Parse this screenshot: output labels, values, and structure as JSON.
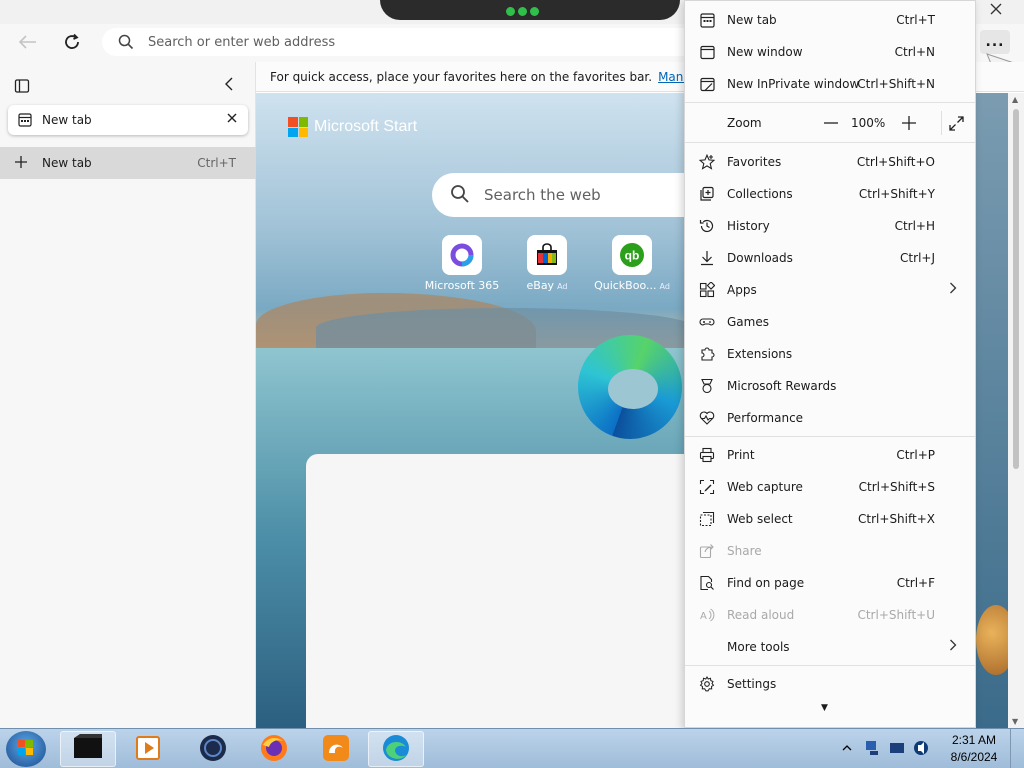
{
  "browser": {
    "address_placeholder": "Search or enter web address",
    "more_button_label": "...",
    "favorites_bar_message": "For quick access, place your favorites here on the favorites bar.",
    "favorites_bar_link": "Manage fav"
  },
  "sidebar": {
    "tabs": [
      {
        "title": "New tab"
      }
    ],
    "new_tab_label": "New tab",
    "new_tab_shortcut": "Ctrl+T"
  },
  "new_tab_page": {
    "logo_label": "Microsoft Start",
    "search_placeholder": "Search the web",
    "quick_links": [
      {
        "label": "Microsoft 365",
        "ad": "",
        "icon": "microsoft-365-icon",
        "color": "#7a4de0"
      },
      {
        "label": "eBay",
        "ad": "Ad",
        "icon": "ebay-bag-icon",
        "color": "#e53238"
      },
      {
        "label": "QuickBoo...",
        "ad": "Ad",
        "icon": "quickbooks-icon",
        "color": "#2ca01c"
      }
    ]
  },
  "menu": {
    "items": [
      {
        "label": "New tab",
        "shortcut": "Ctrl+T",
        "icon": "new-tab-icon"
      },
      {
        "label": "New window",
        "shortcut": "Ctrl+N",
        "icon": "new-window-icon"
      },
      {
        "label": "New InPrivate window",
        "shortcut": "Ctrl+Shift+N",
        "icon": "inprivate-window-icon"
      },
      {
        "label": "Favorites",
        "shortcut": "Ctrl+Shift+O",
        "icon": "star-icon"
      },
      {
        "label": "Collections",
        "shortcut": "Ctrl+Shift+Y",
        "icon": "collections-icon"
      },
      {
        "label": "History",
        "shortcut": "Ctrl+H",
        "icon": "history-icon"
      },
      {
        "label": "Downloads",
        "shortcut": "Ctrl+J",
        "icon": "download-icon"
      },
      {
        "label": "Apps",
        "shortcut": "",
        "icon": "apps-icon",
        "submenu": true
      },
      {
        "label": "Games",
        "shortcut": "",
        "icon": "games-icon"
      },
      {
        "label": "Extensions",
        "shortcut": "",
        "icon": "puzzle-icon"
      },
      {
        "label": "Microsoft Rewards",
        "shortcut": "",
        "icon": "rewards-icon"
      },
      {
        "label": "Performance",
        "shortcut": "",
        "icon": "heartbeat-icon"
      },
      {
        "label": "Print",
        "shortcut": "Ctrl+P",
        "icon": "printer-icon"
      },
      {
        "label": "Web capture",
        "shortcut": "Ctrl+Shift+S",
        "icon": "web-capture-icon"
      },
      {
        "label": "Web select",
        "shortcut": "Ctrl+Shift+X",
        "icon": "web-select-icon"
      },
      {
        "label": "Share",
        "shortcut": "",
        "icon": "share-icon",
        "disabled": true
      },
      {
        "label": "Find on page",
        "shortcut": "Ctrl+F",
        "icon": "find-page-icon"
      },
      {
        "label": "Read aloud",
        "shortcut": "Ctrl+Shift+U",
        "icon": "read-aloud-icon",
        "disabled": true
      },
      {
        "label": "More tools",
        "shortcut": "",
        "icon": "more-tools-icon",
        "submenu": true
      },
      {
        "label": "Settings",
        "shortcut": "",
        "icon": "gear-icon"
      }
    ],
    "zoom": {
      "label": "Zoom",
      "value": "100%",
      "minus": "—",
      "plus": "+"
    }
  },
  "taskbar": {
    "apps": [
      {
        "name": "terminal",
        "icon": "terminal-icon",
        "active": true
      },
      {
        "name": "media-player",
        "icon": "media-player-icon",
        "active": false
      },
      {
        "name": "app-dark-circle",
        "icon": "dark-circle-app-icon",
        "active": false
      },
      {
        "name": "firefox",
        "icon": "firefox-icon",
        "active": false
      },
      {
        "name": "uc-browser",
        "icon": "uc-browser-icon",
        "active": false
      },
      {
        "name": "edge",
        "icon": "edge-icon",
        "active": true
      }
    ],
    "clock": {
      "time": "2:31 AM",
      "date": "8/6/2024"
    }
  }
}
